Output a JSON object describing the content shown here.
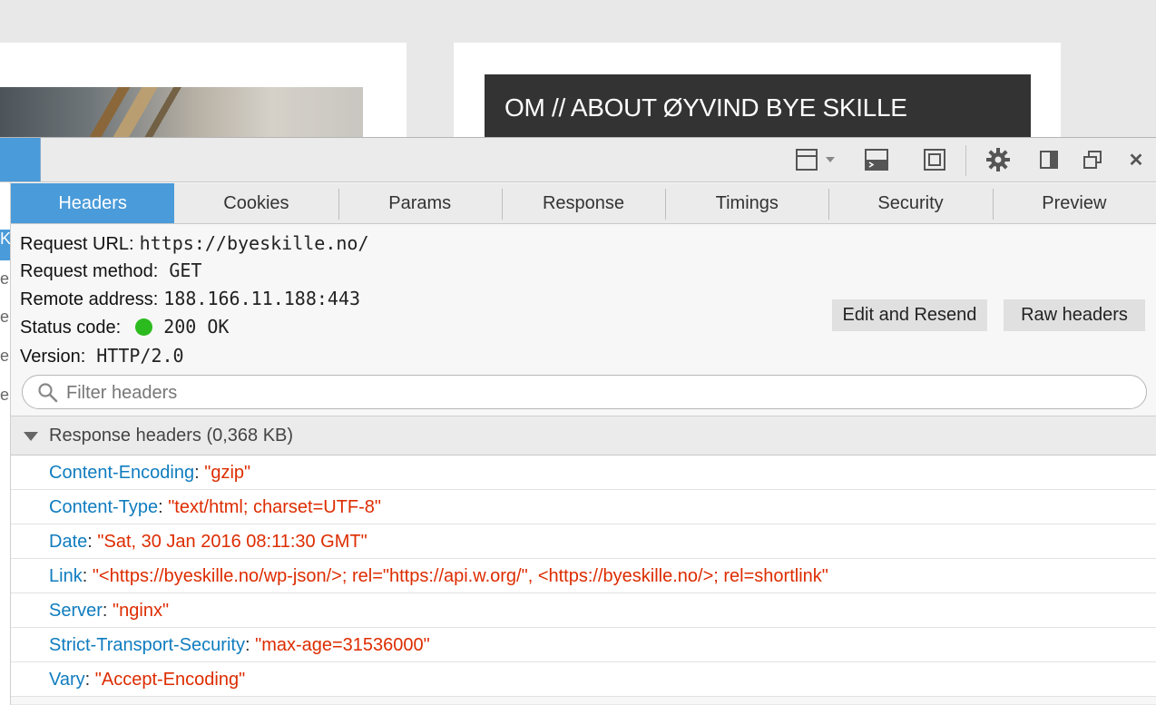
{
  "page": {
    "hero_title": "OM // ABOUT ØYVIND BYE SKILLE"
  },
  "toolbar": {
    "icons": [
      "pick-element-icon",
      "split-console-icon",
      "responsive-mode-icon",
      "settings-gear-icon",
      "dock-side-icon",
      "undock-window-icon",
      "close-icon"
    ],
    "close_glyph": "✕"
  },
  "left_list": [
    "K",
    "e",
    "e",
    "e",
    "e"
  ],
  "tabs": [
    "Headers",
    "Cookies",
    "Params",
    "Response",
    "Timings",
    "Security",
    "Preview"
  ],
  "summary": {
    "url_label": "Request URL:",
    "url_value": "https://byeskille.no/",
    "method_label": "Request method:",
    "method_value": "GET",
    "address_label": "Remote address:",
    "address_value": "188.166.11.188:443",
    "status_label": "Status code:",
    "status_value": "200 OK",
    "version_label": "Version:",
    "version_value": "HTTP/2.0"
  },
  "buttons": {
    "edit_resend": "Edit and Resend",
    "raw_headers": "Raw headers"
  },
  "filter": {
    "placeholder": "Filter headers"
  },
  "response_headers": {
    "title": "Response headers (0,368 KB)",
    "items": [
      {
        "name": "Content-Encoding",
        "value": "\"gzip\""
      },
      {
        "name": "Content-Type",
        "value": "\"text/html; charset=UTF-8\""
      },
      {
        "name": "Date",
        "value": "\"Sat, 30 Jan 2016 08:11:30 GMT\""
      },
      {
        "name": "Link",
        "value": "\"<https://byeskille.no/wp-json/>; rel=\"https://api.w.org/\", <https://byeskille.no/>; rel=shortlink\""
      },
      {
        "name": "Server",
        "value": "\"nginx\""
      },
      {
        "name": "Strict-Transport-Security",
        "value": "\"max-age=31536000\""
      },
      {
        "name": "Vary",
        "value": "\"Accept-Encoding\""
      }
    ]
  },
  "colors": {
    "accent": "#4a9bd9",
    "header_name": "#0f7cbf",
    "header_value": "#dd2c00",
    "status_ok": "#2cbb1e"
  }
}
